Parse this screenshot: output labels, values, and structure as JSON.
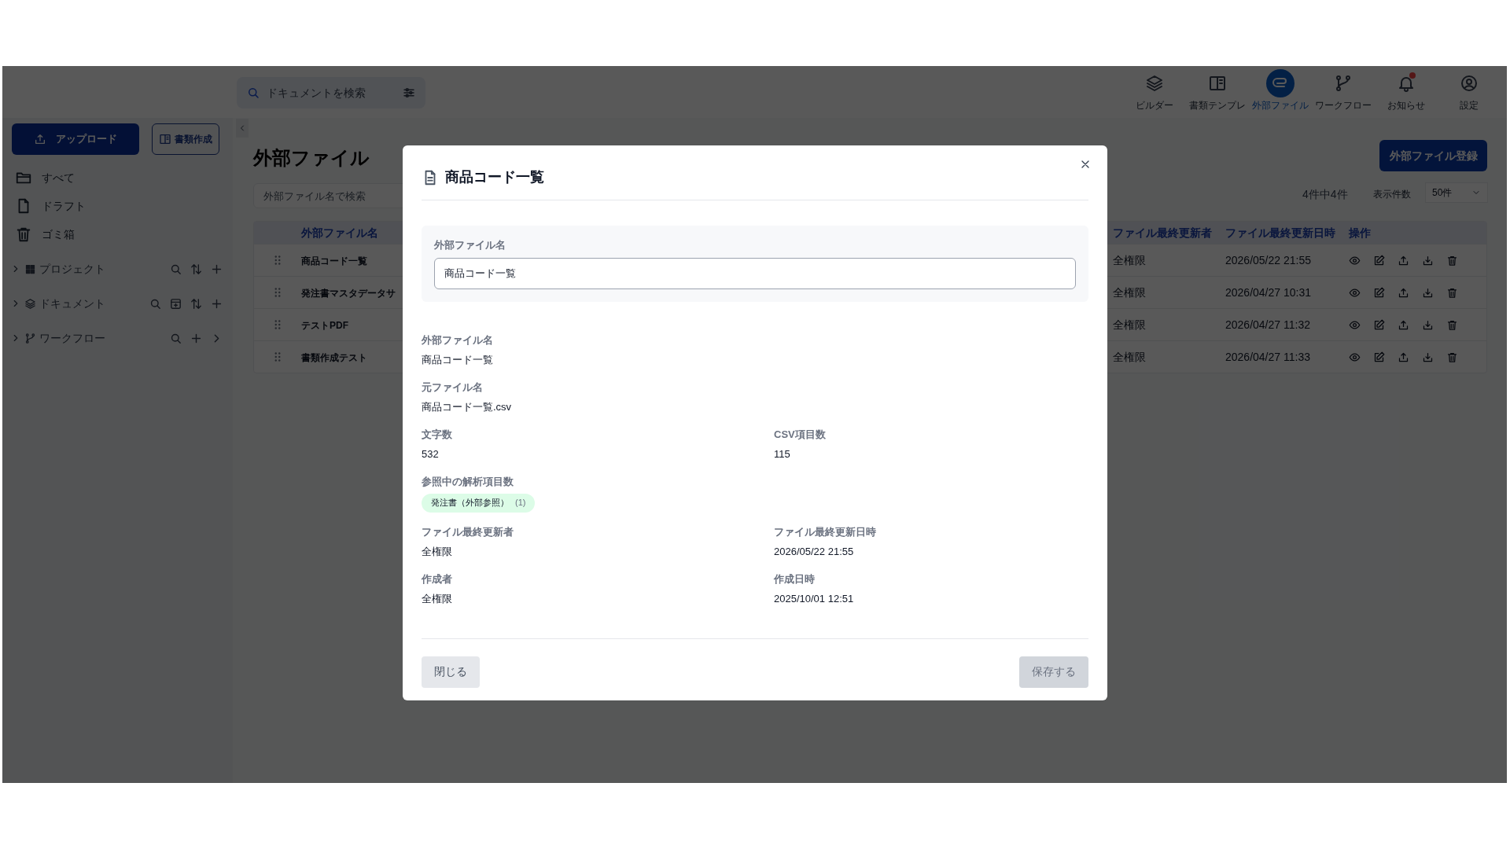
{
  "top_bar": {
    "search": {
      "placeholder": "ドキュメントを検索"
    },
    "nav": [
      {
        "label": "ビルダー",
        "kind": "layers",
        "selected": false,
        "alert": false
      },
      {
        "label": "書類テンプレ",
        "kind": "book",
        "selected": false,
        "alert": false
      },
      {
        "label": "外部ファイル",
        "kind": "clip",
        "selected": true,
        "alert": false
      },
      {
        "label": "ワークフロー",
        "kind": "branch",
        "selected": false,
        "alert": false
      },
      {
        "label": "お知らせ",
        "kind": "bell",
        "selected": false,
        "alert": true
      },
      {
        "label": "設定",
        "kind": "user",
        "selected": false,
        "alert": false
      }
    ]
  },
  "sidebar": {
    "upload_button": "アップロード",
    "create_button": "書類作成",
    "items": [
      {
        "label": "すべて",
        "kind": "folder"
      },
      {
        "label": "ドラフト",
        "kind": "file"
      },
      {
        "label": "ゴミ箱",
        "kind": "trash"
      }
    ],
    "sections": [
      {
        "label": "プロジェクト",
        "kind": "project",
        "expanded": false
      },
      {
        "label": "ドキュメント",
        "kind": "document",
        "expanded": false
      },
      {
        "label": "ワークフロー",
        "kind": "workflow",
        "expanded": false
      }
    ]
  },
  "main": {
    "title": "外部ファイル",
    "search": {
      "placeholder": "外部ファイル名で検索"
    },
    "register_button": "外部ファイル登録",
    "count": "4件中4件",
    "per_page_label": "表示件数",
    "per_page": "50件",
    "table": {
      "columns": [
        "外部ファイル名",
        "ファイル最終更新者",
        "ファイル最終更新日時",
        "操作"
      ],
      "rows": [
        {
          "name": "商品コード一覧",
          "updated_by": "全権限",
          "updated_at": "2026/05/22 21:55"
        },
        {
          "name": "発注書マスタデータサ",
          "updated_by": "全権限",
          "updated_at": "2026/04/27 10:31"
        },
        {
          "name": "テストPDF",
          "updated_by": "全権限",
          "updated_at": "2026/04/27 11:32"
        },
        {
          "name": "書類作成テスト",
          "updated_by": "全権限",
          "updated_at": "2026/04/27 11:33"
        }
      ]
    }
  },
  "dialog": {
    "title": "商品コード一覧",
    "field": {
      "label": "外部ファイル名",
      "value": "商品コード一覧"
    },
    "details": [
      [
        {
          "kind": "text",
          "label": "外部ファイル名",
          "value": "商品コード一覧"
        }
      ],
      [
        {
          "kind": "text",
          "label": "元ファイル名",
          "value": "商品コード一覧.csv"
        }
      ],
      [
        {
          "kind": "text",
          "label": "文字数",
          "value": "532"
        },
        {
          "kind": "text",
          "label": "CSV項目数",
          "value": "115"
        }
      ],
      [
        {
          "kind": "tags",
          "label": "参照中の解析項目数",
          "tags": [
            {
              "label": "発注書（外部参照）",
              "count": "(1)"
            }
          ]
        }
      ],
      [
        {
          "kind": "text",
          "label": "ファイル最終更新者",
          "value": "全権限"
        },
        {
          "kind": "text",
          "label": "ファイル最終更新日時",
          "value": "2026/05/22 21:55"
        }
      ],
      [
        {
          "kind": "text",
          "label": "作成者",
          "value": "全権限"
        },
        {
          "kind": "text",
          "label": "作成日時",
          "value": "2025/10/01 12:51"
        }
      ]
    ],
    "close_button": {
      "label": "閉じる"
    },
    "save_button": {
      "label": "保存する",
      "disabled": true
    }
  }
}
